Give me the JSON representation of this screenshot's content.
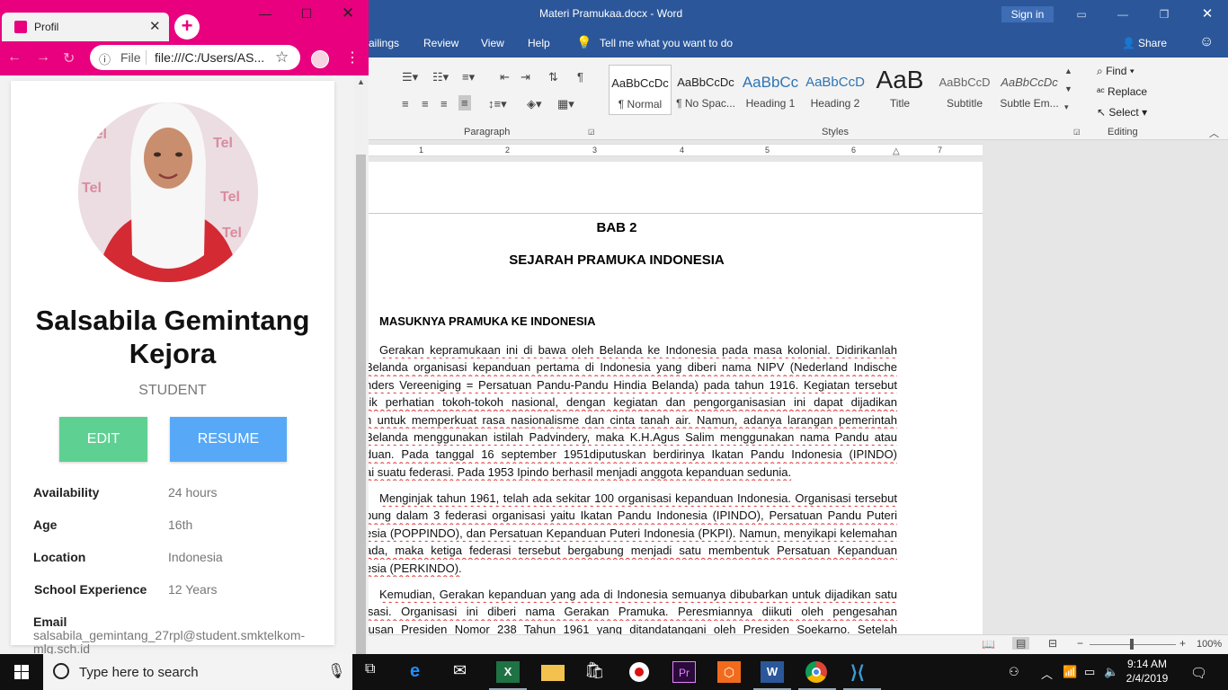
{
  "word": {
    "title": "Materi Pramukaa.docx  -  Word",
    "signin": "Sign in",
    "tabs": [
      "ailings",
      "Review",
      "View",
      "Help"
    ],
    "tell_me": "Tell me what you want to do",
    "share": "Share",
    "ribbon": {
      "paragraph_label": "Paragraph",
      "styles_label": "Styles",
      "editing_label": "Editing",
      "styles": [
        {
          "sample": "AaBbCcDc",
          "name": "¶ Normal"
        },
        {
          "sample": "AaBbCcDc",
          "name": "¶ No Spac..."
        },
        {
          "sample": "AaBbCc",
          "name": "Heading 1"
        },
        {
          "sample": "AaBbCcD",
          "name": "Heading 2"
        },
        {
          "sample": "AaB",
          "name": "Title"
        },
        {
          "sample": "AaBbCcD",
          "name": "Subtitle"
        },
        {
          "sample": "AaBbCcDc",
          "name": "Subtle Em..."
        }
      ],
      "find": "Find",
      "replace": "Replace",
      "select": "Select"
    },
    "ruler_numbers": [
      "1",
      "2",
      "3",
      "4",
      "5",
      "6",
      "7"
    ],
    "document": {
      "heading1": "BAB 2",
      "heading2": "SEJARAH PRAMUKA INDONESIA",
      "subheading": "MASUKNYA PRAMUKA KE INDONESIA",
      "para1": [
        "Gerakan kepramukaan ini di bawa oleh Belanda ke Indonesia pada masa kolonial. Didirikanlah",
        "Belanda organisasi kepanduan pertama di Indonesia yang diberi nama NIPV (Nederland Indische",
        "nders Vereeniging = Persatuan Pandu-Pandu Hindia Belanda) pada tahun 1916. Kegiatan tersebut",
        "rik perhatian tokoh-tokoh nasional, dengan kegiatan dan pengorganisasian ini dapat dijadikan",
        "n untuk memperkuat rasa nasionalisme dan cinta tanah air. Namun, adanya larangan pemerintah",
        "Belanda menggunakan istilah Padvindery, maka K.H.Agus Salim menggunakan nama Pandu atau",
        "duan. Pada tanggal 16 september 1951diputuskan berdirinya Ikatan Pandu Indonesia (IPINDO)",
        "ai suatu federasi. Pada 1953 Ipindo berhasil menjadi anggota kepanduan sedunia."
      ],
      "para2": [
        "Menginjak tahun 1961, telah ada sekitar 100 organisasi kepanduan Indonesia. Organisasi tersebut",
        "bung dalam 3 federasi organisasi yaitu Ikatan Pandu Indonesia (IPINDO), Persatuan Pandu Puteri",
        "esia (POPPINDO), dan Persatuan Kepanduan Puteri Indonesia (PKPI). Namun, menyikapi kelemahan",
        "ada, maka ketiga federasi tersebut bergabung menjadi satu membentuk Persatuan Kepanduan",
        "esia (PERKINDO)."
      ],
      "para3": [
        "Kemudian, Gerakan kepanduan yang ada di Indonesia semuanya dibubarkan untuk dijadikan satu",
        "isasi. Organisasi ini diberi nama Gerakan Pramuka. Peresmiannya diikuti oleh pengesahan",
        "tusan Presiden Nomor 238 Tahun 1961 yang ditandatangani oleh Presiden Soekarno. Setelah"
      ]
    },
    "zoom": "100%"
  },
  "chrome": {
    "tab_title": "Profil",
    "url_scheme": "File",
    "url": "file:///C:/Users/AS...",
    "accent_color": "#e8007f"
  },
  "profile": {
    "name": "Salsabila Gemintang Kejora",
    "role": "STUDENT",
    "edit_label": "EDIT",
    "resume_label": "RESUME",
    "fields": [
      {
        "label": "Availability",
        "value": "24 hours"
      },
      {
        "label": "Age",
        "value": "16th"
      },
      {
        "label": "Location",
        "value": "Indonesia"
      },
      {
        "label": "School Experience",
        "value": "12 Years"
      }
    ],
    "email_label": "Email",
    "email_value": "salsabila_gemintang_27rpl@student.smktelkom-mlg.sch.id"
  },
  "taskbar": {
    "search_placeholder": "Type here to search",
    "time": "9:14 AM",
    "date": "2/4/2019",
    "apps": [
      "task-view-icon",
      "edge-icon",
      "mail-icon",
      "excel-icon",
      "file-explorer-icon",
      "store-icon",
      "recorder-icon",
      "premiere-icon",
      "app-icon",
      "word-icon",
      "chrome-icon",
      "vscode-icon"
    ]
  }
}
